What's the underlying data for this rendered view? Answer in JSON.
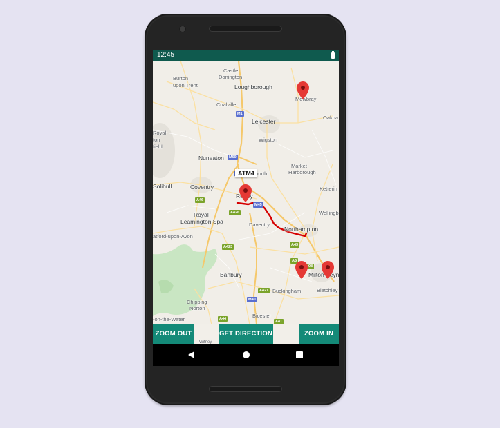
{
  "status_bar": {
    "time": "12:45",
    "battery_icon": "battery-full-icon"
  },
  "map": {
    "labels": {
      "burton": "Burton\nupon Trent",
      "castle_donington": "Castle\nDonington",
      "loughborough": "Loughborough",
      "melton_mowbray": "Mowbray",
      "coalville": "Coalville",
      "leicester": "Leicester",
      "oakham": "Oakha",
      "wigston": "Wigston",
      "nuneaton": "Nuneaton",
      "market_harborough": "Market\nHarborough",
      "solihull": "Solihull",
      "coventry": "Coventry",
      "rugby": "Rugby",
      "kettering": "Ketterin",
      "royal_leamington_spa": "Royal\nLeamington Spa",
      "daventry": "Daventry",
      "wellingborough": "Wellingb",
      "northampton": "Northampton",
      "stratford": "atford-upon-Avon",
      "banbury": "Banbury",
      "milton_keynes": "Milton Keyn",
      "bletchley": "Bletchley",
      "buckingham": "Buckingham",
      "chipping_norton": "Chipping\nNorton",
      "bicester": "Bicester",
      "on_the_water": "-on-the-Water",
      "lichfield": "Royal\nton\nfield",
      "nworth": "worth",
      "witney": "Witney"
    },
    "road_badges": {
      "m1": "M1",
      "m69": "M69",
      "m6": "M6",
      "m45": "M45",
      "m40": "M40",
      "a46": "A46",
      "a426": "A426",
      "a423": "A423",
      "a43": "A43",
      "a5": "A5",
      "a421": "A421",
      "a44": "A44",
      "a41": "A41",
      "a08": "08"
    },
    "info_window_title": "ATM4",
    "marker_icon": "map-pin-icon",
    "route_color": "#d50000"
  },
  "buttons": {
    "zoom_out": "ZOOM OUT",
    "get_direction": "GET DIRECTION",
    "zoom_in": "ZOOM IN"
  },
  "nav": {
    "back_icon": "back-icon",
    "home_icon": "home-icon",
    "recent_icon": "recent-apps-icon"
  },
  "colors": {
    "primary": "#148a78",
    "status_bar": "#0f5a4e"
  }
}
